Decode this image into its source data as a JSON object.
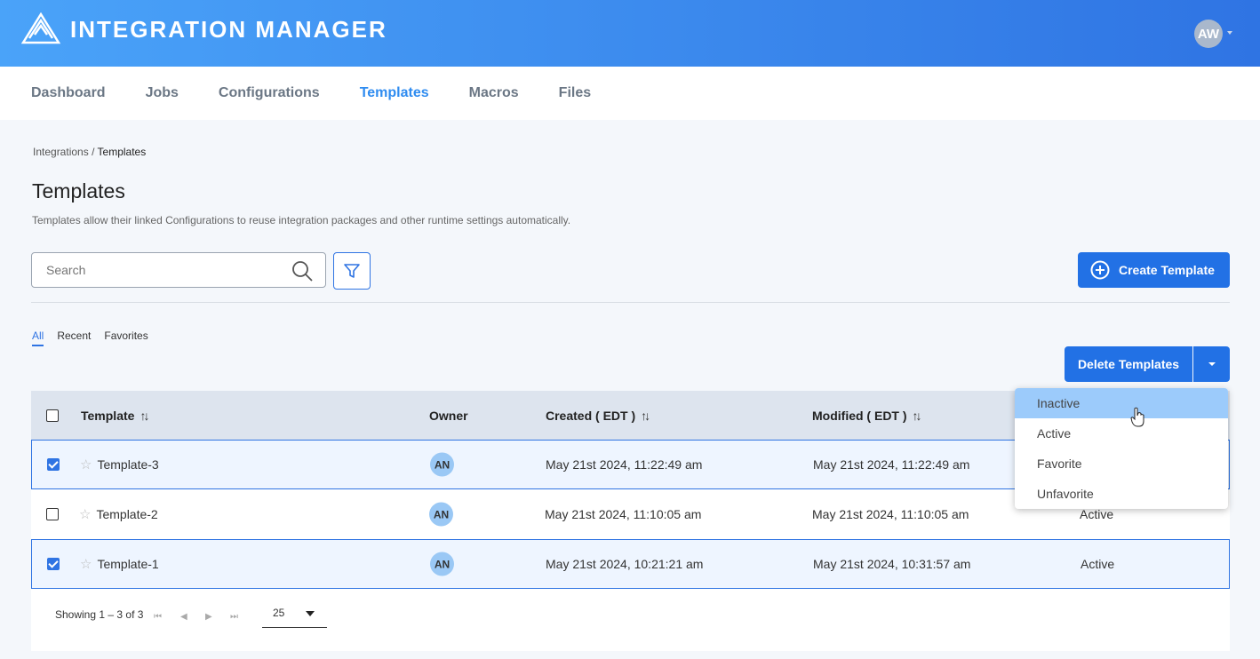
{
  "app": {
    "title": "INTEGRATION MANAGER",
    "user_initials": "AW"
  },
  "nav": [
    {
      "label": "Dashboard"
    },
    {
      "label": "Jobs"
    },
    {
      "label": "Configurations"
    },
    {
      "label": "Templates",
      "active": true
    },
    {
      "label": "Macros"
    },
    {
      "label": "Files"
    }
  ],
  "breadcrumb": {
    "parent": "Integrations",
    "separator": "/",
    "current": "Templates"
  },
  "page": {
    "title": "Templates",
    "description": "Templates allow their linked Configurations to reuse integration packages and other runtime settings automatically."
  },
  "search": {
    "placeholder": "Search",
    "value": ""
  },
  "buttons": {
    "create": "Create Template",
    "delete": "Delete Templates"
  },
  "tabs": [
    {
      "label": "All",
      "active": true
    },
    {
      "label": "Recent"
    },
    {
      "label": "Favorites"
    }
  ],
  "table": {
    "columns": {
      "template": "Template",
      "owner": "Owner",
      "created": "Created ( EDT )",
      "modified": "Modified ( EDT )"
    },
    "rows": [
      {
        "selected": true,
        "name": "Template-3",
        "owner": "AN",
        "created": "May 21st 2024, 11:22:49 am",
        "modified": "May 21st 2024, 11:22:49 am",
        "status": ""
      },
      {
        "selected": false,
        "name": "Template-2",
        "owner": "AN",
        "created": "May 21st 2024, 11:10:05 am",
        "modified": "May 21st 2024, 11:10:05 am",
        "status": "Active"
      },
      {
        "selected": true,
        "name": "Template-1",
        "owner": "AN",
        "created": "May 21st 2024, 10:21:21 am",
        "modified": "May 21st 2024, 10:31:57 am",
        "status": "Active"
      }
    ]
  },
  "pagination": {
    "showing": "Showing 1 – 3 of 3",
    "page_size": "25"
  },
  "dropdown": {
    "items": [
      "Inactive",
      "Active",
      "Favorite",
      "Unfavorite"
    ],
    "hovered": "Inactive"
  },
  "colors": {
    "primary": "#2271e5",
    "header_start": "#4aa3f9",
    "header_end": "#2f74e3",
    "hover": "#9ccbfb"
  }
}
